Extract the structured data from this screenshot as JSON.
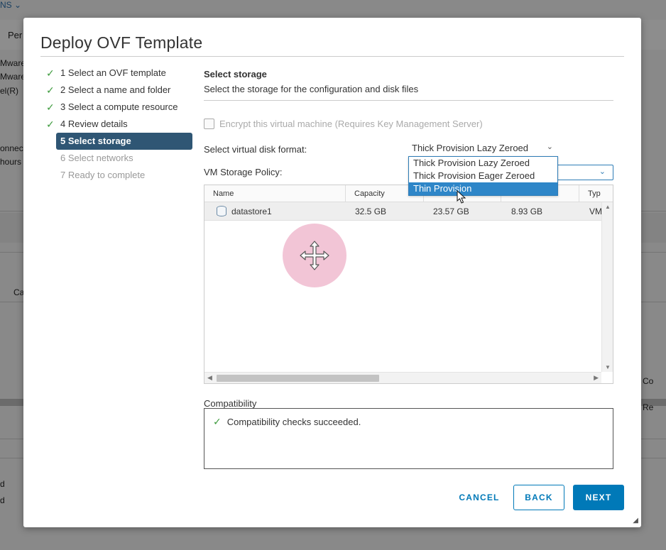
{
  "background": {
    "texts": [
      "NS ⌄",
      "Per",
      "Mware",
      "Mware",
      "el(R)",
      "onnec",
      "hours",
      "Ca",
      "d",
      "d",
      "Co",
      "Re"
    ]
  },
  "modal": {
    "title": "Deploy OVF Template"
  },
  "steps": [
    {
      "label": "1 Select an OVF template",
      "state": "done"
    },
    {
      "label": "2 Select a name and folder",
      "state": "done"
    },
    {
      "label": "3 Select a compute resource",
      "state": "done"
    },
    {
      "label": "4 Review details",
      "state": "done"
    },
    {
      "label": "5 Select storage",
      "state": "active"
    },
    {
      "label": "6 Select networks",
      "state": "future"
    },
    {
      "label": "7 Ready to complete",
      "state": "future"
    }
  ],
  "section": {
    "title": "Select storage",
    "subtitle": "Select the storage for the configuration and disk files"
  },
  "encrypt": {
    "label": "Encrypt this virtual machine (Requires Key Management Server)",
    "checked": false
  },
  "disk_format": {
    "label": "Select virtual disk format:",
    "value": "Thick Provision Lazy Zeroed",
    "options": [
      "Thick Provision Lazy Zeroed",
      "Thick Provision Eager Zeroed",
      "Thin Provision"
    ],
    "highlighted": "Thin Provision"
  },
  "policy": {
    "label": "VM Storage Policy:",
    "value": ""
  },
  "table": {
    "columns": [
      "Name",
      "Capacity",
      "",
      "",
      "Typ"
    ],
    "rows": [
      {
        "name": "datastore1",
        "capacity": "32.5 GB",
        "provisioned": "23.57 GB",
        "free": "8.93 GB",
        "type": "VM"
      }
    ]
  },
  "compatibility": {
    "label": "Compatibility",
    "message": "Compatibility checks succeeded."
  },
  "buttons": {
    "cancel": "CANCEL",
    "back": "BACK",
    "next": "NEXT"
  },
  "colors": {
    "active_step": "#2f5674",
    "primary": "#0079b8",
    "check": "#3c9a3c",
    "dropdown_highlight": "#2e86c8"
  }
}
